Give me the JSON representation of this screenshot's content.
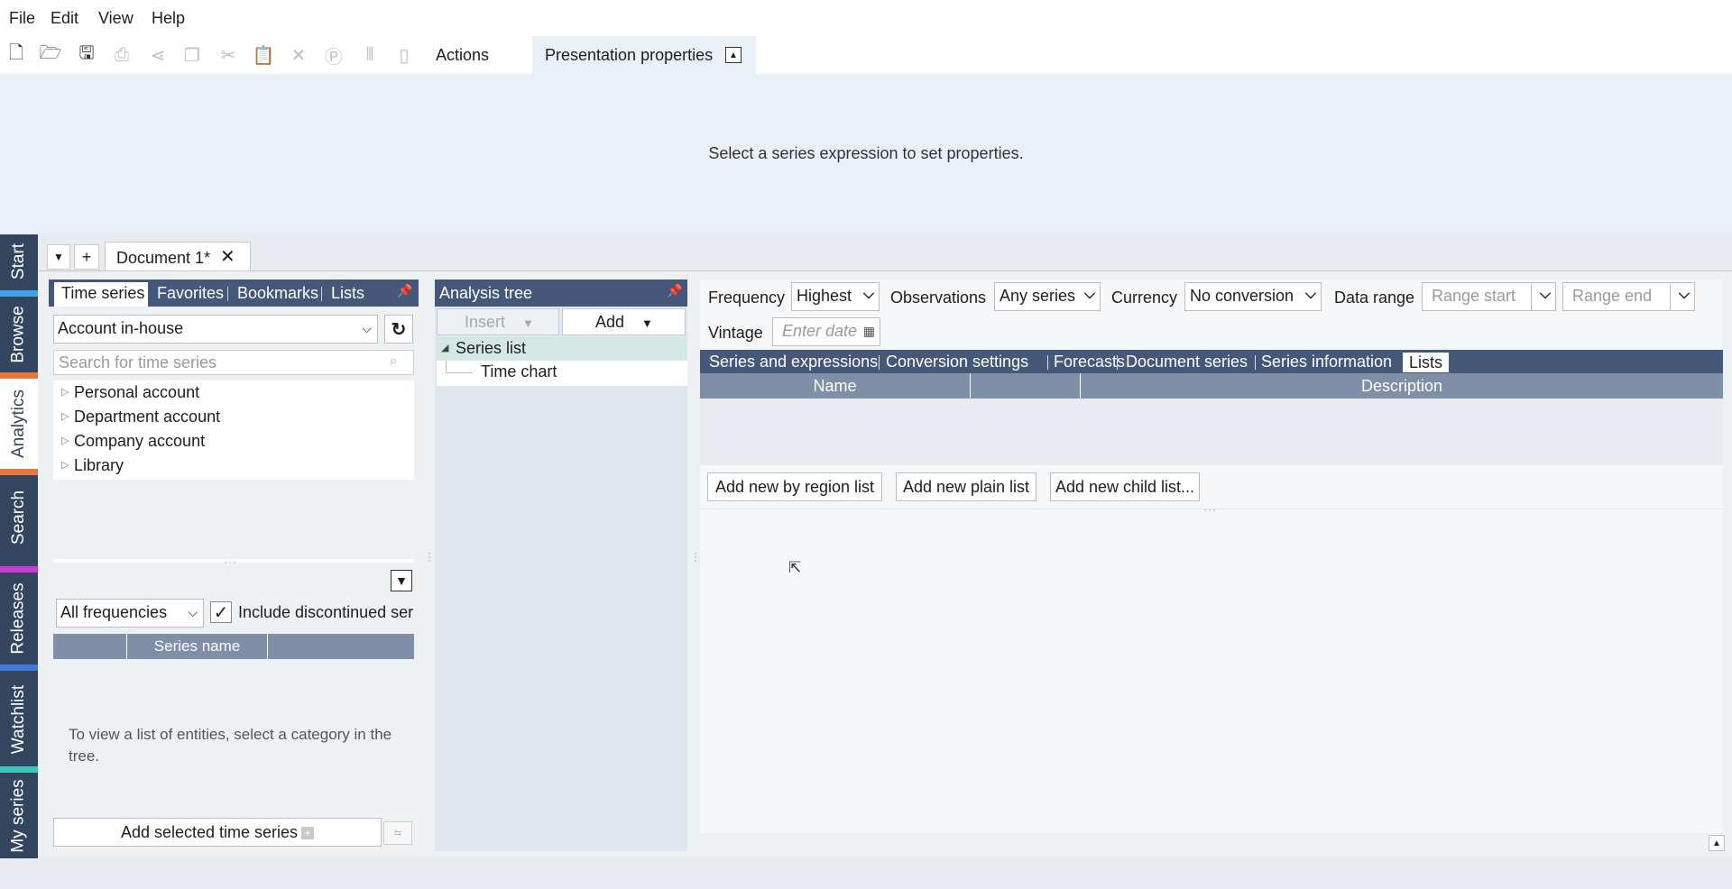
{
  "menu": {
    "file": "File",
    "edit": "Edit",
    "view": "View",
    "help": "Help"
  },
  "toolbar": {
    "actions_tab": "Actions",
    "presentation_tab": "Presentation properties",
    "presentation_message": "Select a series expression to set properties."
  },
  "left_nav": {
    "tabs": [
      "Start",
      "Browse",
      "Analytics",
      "Search",
      "Releases",
      "Watchlist",
      "My series"
    ],
    "active": "Analytics",
    "separator_colors": [
      "#3ba5e8",
      "#e8793b",
      "#e8793b",
      "#c63bd6",
      "#3b7ad6",
      "#3bc6c0"
    ]
  },
  "document": {
    "tab_title": "Document 1*"
  },
  "time_series_panel": {
    "tabs": [
      "Time series",
      "Favorites",
      "Bookmarks",
      "Lists"
    ],
    "account_value": "Account in-house",
    "search_placeholder": "Search for time series",
    "tree": [
      "Personal account",
      "Department account",
      "Company account",
      "Library"
    ],
    "frequency_value": "All frequencies",
    "include_discontinued_label": "Include discontinued ser",
    "include_discontinued_checked": true,
    "columns": [
      "",
      "Series name",
      ""
    ],
    "empty_message": "To view a list of entities, select a category in the tree.",
    "add_selected_label": "Add selected time series"
  },
  "analysis_tree": {
    "title": "Analysis tree",
    "insert_label": "Insert",
    "add_label": "Add",
    "items": [
      "Series list",
      "Time chart"
    ]
  },
  "settings": {
    "frequency_label": "Frequency",
    "frequency_value": "Highest",
    "observations_label": "Observations",
    "observations_value": "Any series",
    "currency_label": "Currency",
    "currency_value": "No conversion",
    "data_range_label": "Data range",
    "range_start_placeholder": "Range start",
    "range_end_placeholder": "Range end",
    "vintage_label": "Vintage",
    "vintage_placeholder": "Enter date"
  },
  "lists_panel": {
    "tabs": [
      "Series and expressions",
      "Conversion settings",
      "Forecasts",
      "Document series",
      "Series information",
      "Lists"
    ],
    "active": "Lists",
    "columns": [
      "Name",
      "",
      "Description"
    ],
    "buttons": [
      "Add new by region list",
      "Add new plain list",
      "Add new child list..."
    ]
  }
}
